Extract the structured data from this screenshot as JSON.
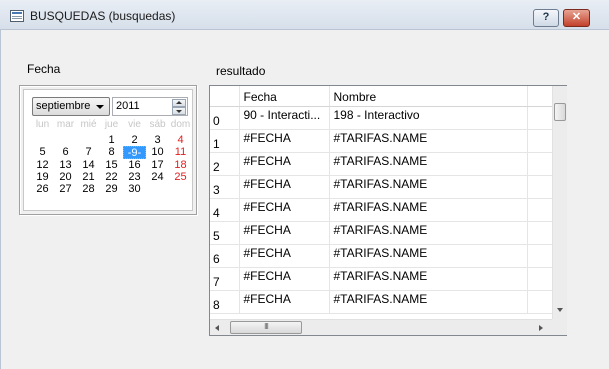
{
  "window": {
    "title": "BUSQUEDAS (busquedas)",
    "help_label": "?",
    "close_label": "✕"
  },
  "labels": {
    "fecha": "Fecha",
    "resultado": "resultado"
  },
  "calendar": {
    "month": "septiembre",
    "year": "2011",
    "weekdays": [
      "lun",
      "mar",
      "mié",
      "jue",
      "vie",
      "sáb",
      "dom"
    ],
    "selected_day": "9",
    "weeks": [
      [
        "",
        "",
        "",
        "1",
        "2",
        "3",
        "4"
      ],
      [
        "5",
        "6",
        "7",
        "8",
        "9",
        "10",
        "11"
      ],
      [
        "12",
        "13",
        "14",
        "15",
        "16",
        "17",
        "18"
      ],
      [
        "19",
        "20",
        "21",
        "22",
        "23",
        "24",
        "25"
      ],
      [
        "26",
        "27",
        "28",
        "29",
        "30",
        "",
        ""
      ]
    ]
  },
  "grid": {
    "columns": [
      "",
      "Fecha",
      "Nombre",
      ""
    ],
    "rows": [
      {
        "index": "0",
        "fecha": "90 - Interacti...",
        "nombre": "198 - Interactivo"
      },
      {
        "index": "1",
        "fecha": "#FECHA",
        "nombre": "#TARIFAS.NAME"
      },
      {
        "index": "2",
        "fecha": "#FECHA",
        "nombre": "#TARIFAS.NAME"
      },
      {
        "index": "3",
        "fecha": "#FECHA",
        "nombre": "#TARIFAS.NAME"
      },
      {
        "index": "4",
        "fecha": "#FECHA",
        "nombre": "#TARIFAS.NAME"
      },
      {
        "index": "5",
        "fecha": "#FECHA",
        "nombre": "#TARIFAS.NAME"
      },
      {
        "index": "6",
        "fecha": "#FECHA",
        "nombre": "#TARIFAS.NAME"
      },
      {
        "index": "7",
        "fecha": "#FECHA",
        "nombre": "#TARIFAS.NAME"
      },
      {
        "index": "8",
        "fecha": "#FECHA",
        "nombre": "#TARIFAS.NAME"
      }
    ],
    "hscroll_thumb_grip": "III"
  }
}
